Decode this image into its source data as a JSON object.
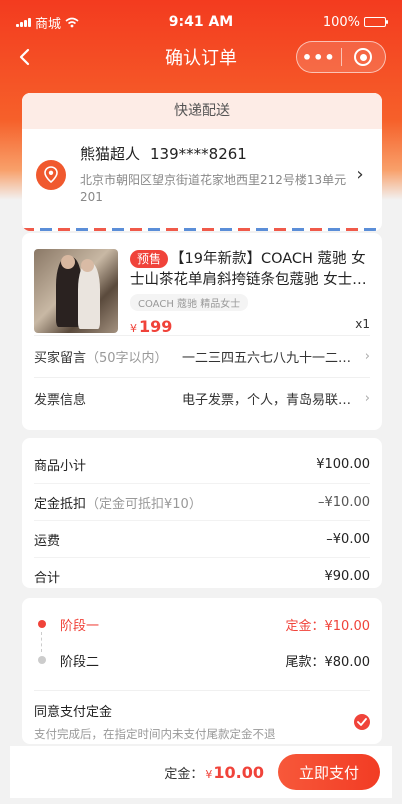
{
  "status_bar": {
    "carrier": "商城",
    "time": "9:41 AM",
    "battery": "100%"
  },
  "nav": {
    "title": "确认订单",
    "more_label": "•••"
  },
  "address": {
    "delivery_tab": "快递配送",
    "name": "熊猫超人",
    "phone": "139****8261",
    "detail": "北京市朝阳区望京街道花家地西里212号楼13单元201",
    "arrow": "›"
  },
  "product": {
    "badge": "预售",
    "title": "【19年新款】COACH 蔻驰 女士山茶花单肩斜挎链条包蔻驰 女士…",
    "tag": "COACH 蔻驰 精品女士",
    "price_symbol": "¥",
    "price": "199",
    "quantity": "x1"
  },
  "order_options": [
    {
      "label": "买家留言",
      "hint": "（50字以内）",
      "value": "一二三四五六七八九十一二三…"
    },
    {
      "label": "发票信息",
      "hint": "",
      "value": "电子发票，个人，青岛易联互…"
    }
  ],
  "summary": [
    {
      "label": "商品小计",
      "hint": "",
      "value": "¥100.00"
    },
    {
      "label": "定金抵扣",
      "hint": "（定金可抵扣¥10）",
      "value": "–¥10.00"
    },
    {
      "label": "运费",
      "hint": "",
      "value": "–¥0.00"
    },
    {
      "label": "合计",
      "hint": "",
      "value": "¥90.00"
    }
  ],
  "stages": [
    {
      "name": "阶段一",
      "value": "定金：¥10.00",
      "color": "#f0433a"
    },
    {
      "name": "阶段二",
      "value": "尾款：¥80.00",
      "color": "#222222"
    }
  ],
  "agreement": {
    "title": "同意支付定金",
    "subtitle": "支付完成后，在指定时间内未支付尾款定金不退",
    "checked": true
  },
  "footer": {
    "deposit_label": "定金：",
    "deposit_symbol": "¥",
    "deposit_amount": "10.00",
    "pay_button": "立即支付"
  },
  "colors": {
    "primary": "#f0433a",
    "header": "#f33b1f"
  }
}
